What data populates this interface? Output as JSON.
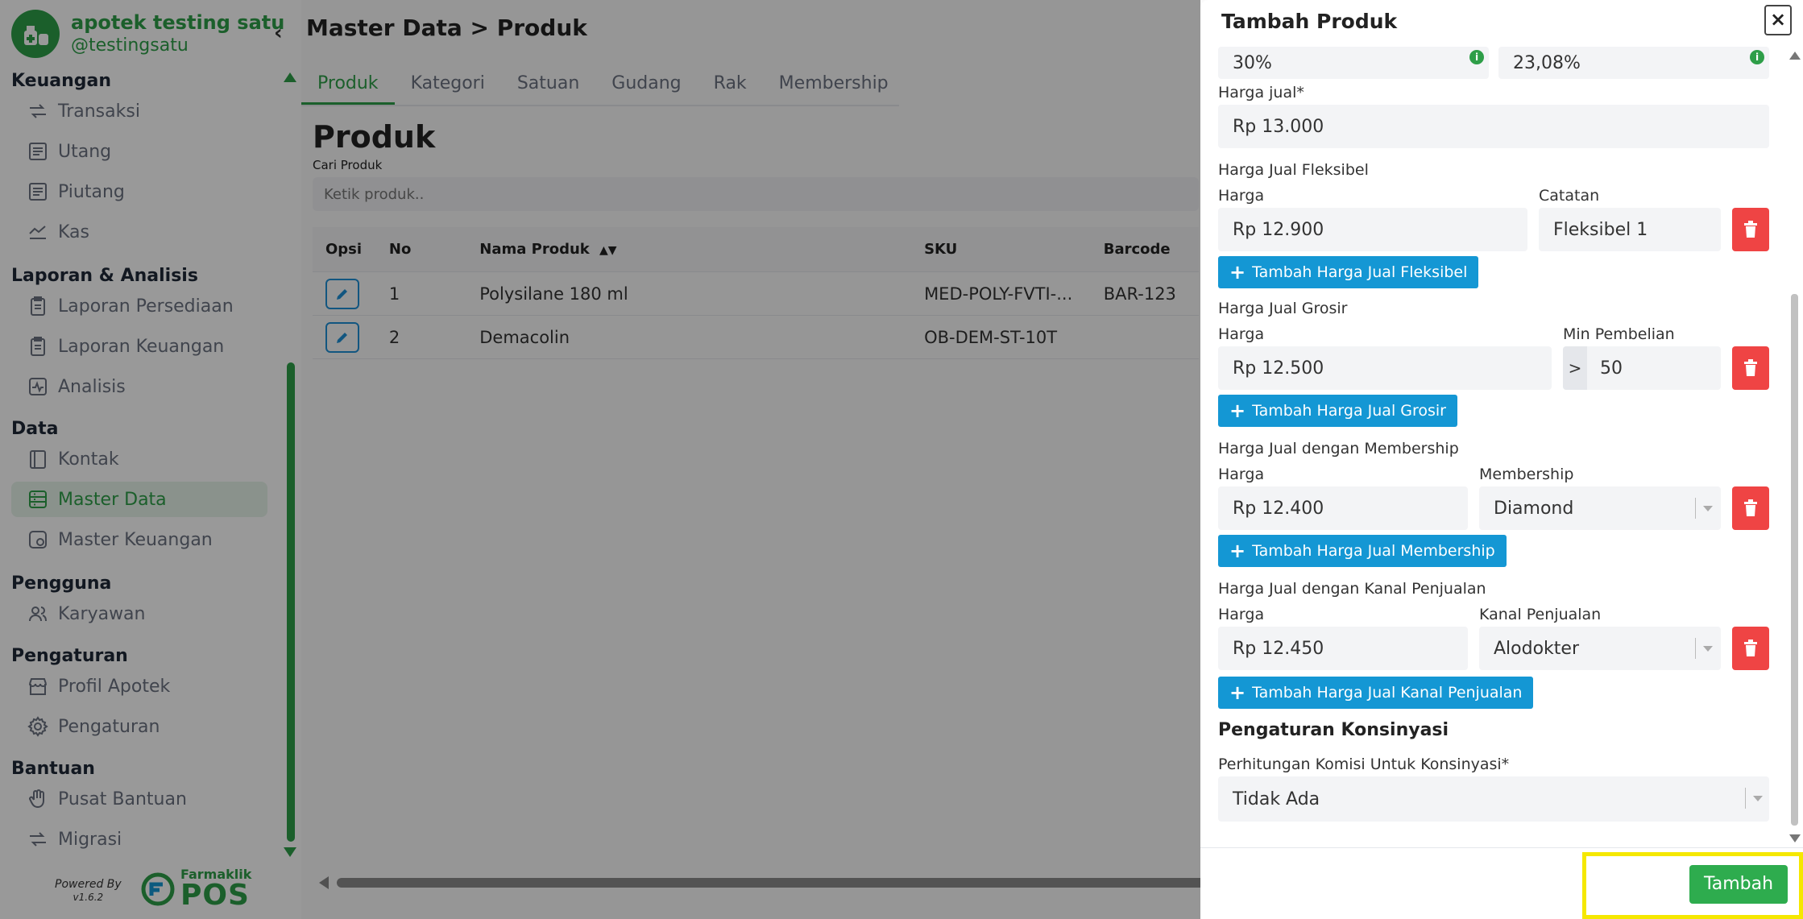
{
  "app": {
    "name": "apotek testing satu",
    "handle": "@testingsatu",
    "powered_by": "Powered By",
    "version": "v1.6.2",
    "brand_small": "Farmaklik",
    "brand_big": "POS",
    "accent": "#2e9e48"
  },
  "sidebar": {
    "sections": [
      {
        "title": "Keuangan",
        "items": [
          {
            "label": "Transaksi",
            "icon": "transaction-icon"
          },
          {
            "label": "Utang",
            "icon": "list-icon"
          },
          {
            "label": "Piutang",
            "icon": "list-icon"
          },
          {
            "label": "Kas",
            "icon": "cash-icon"
          }
        ]
      },
      {
        "title": "Laporan & Analisis",
        "items": [
          {
            "label": "Laporan Persediaan",
            "icon": "clipboard-icon"
          },
          {
            "label": "Laporan Keuangan",
            "icon": "clipboard-icon"
          },
          {
            "label": "Analisis",
            "icon": "pulse-icon"
          }
        ]
      },
      {
        "title": "Data",
        "items": [
          {
            "label": "Kontak",
            "icon": "book-icon"
          },
          {
            "label": "Master Data",
            "icon": "database-icon"
          },
          {
            "label": "Master Keuangan",
            "icon": "finance-icon"
          }
        ]
      },
      {
        "title": "Pengguna",
        "items": [
          {
            "label": "Karyawan",
            "icon": "users-icon"
          }
        ]
      },
      {
        "title": "Pengaturan",
        "items": [
          {
            "label": "Profil Apotek",
            "icon": "store-icon"
          },
          {
            "label": "Pengaturan",
            "icon": "gear-icon"
          }
        ]
      },
      {
        "title": "Bantuan",
        "items": [
          {
            "label": "Pusat Bantuan",
            "icon": "hand-icon"
          },
          {
            "label": "Migrasi",
            "icon": "migrate-icon"
          }
        ]
      }
    ]
  },
  "main": {
    "breadcrumb": "Master Data > Produk",
    "tabs": [
      "Produk",
      "Kategori",
      "Satuan",
      "Gudang",
      "Rak",
      "Membership"
    ],
    "active_tab": "Produk",
    "section_title": "Produk",
    "search_label": "Cari Produk",
    "search_placeholder": "Ketik produk..",
    "table": {
      "headers": [
        "Opsi",
        "No",
        "Nama Produk",
        "SKU",
        "Barcode"
      ],
      "rows": [
        {
          "no": "1",
          "nama": "Polysilane 180 ml",
          "sku": "MED-POLY-FVTI-...",
          "barcode": "BAR-123"
        },
        {
          "no": "2",
          "nama": "Demacolin",
          "sku": "OB-DEM-ST-10T",
          "barcode": ""
        }
      ]
    }
  },
  "modal": {
    "title": "Tambah Produk",
    "close": "×",
    "margin_left": "30%",
    "margin_right": "23,08%",
    "harga_jual_label": "Harga jual*",
    "harga_jual_value": "Rp 13.000",
    "fleksibel": {
      "group": "Harga Jual Fleksibel",
      "harga_label": "Harga",
      "catatan_label": "Catatan",
      "harga": "Rp 12.900",
      "catatan": "Fleksibel 1",
      "add": "Tambah Harga Jual Fleksibel"
    },
    "grosir": {
      "group": "Harga Jual Grosir",
      "harga_label": "Harga",
      "min_label": "Min Pembelian",
      "harga": "Rp 12.500",
      "prefix": ">",
      "min": "50",
      "add": "Tambah Harga Jual Grosir"
    },
    "membership": {
      "group": "Harga Jual dengan Membership",
      "harga_label": "Harga",
      "membership_label": "Membership",
      "harga": "Rp 12.400",
      "membership": "Diamond",
      "add": "Tambah Harga Jual Membership"
    },
    "kanal": {
      "group": "Harga Jual dengan Kanal Penjualan",
      "harga_label": "Harga",
      "kanal_label": "Kanal Penjualan",
      "harga": "Rp 12.450",
      "kanal": "Alodokter",
      "add": "Tambah Harga Jual Kanal Penjualan"
    },
    "konsinyasi": {
      "title": "Pengaturan Konsinyasi",
      "label": "Perhitungan Komisi Untuk Konsinyasi*",
      "value": "Tidak Ada"
    },
    "submit": "Tambah"
  }
}
